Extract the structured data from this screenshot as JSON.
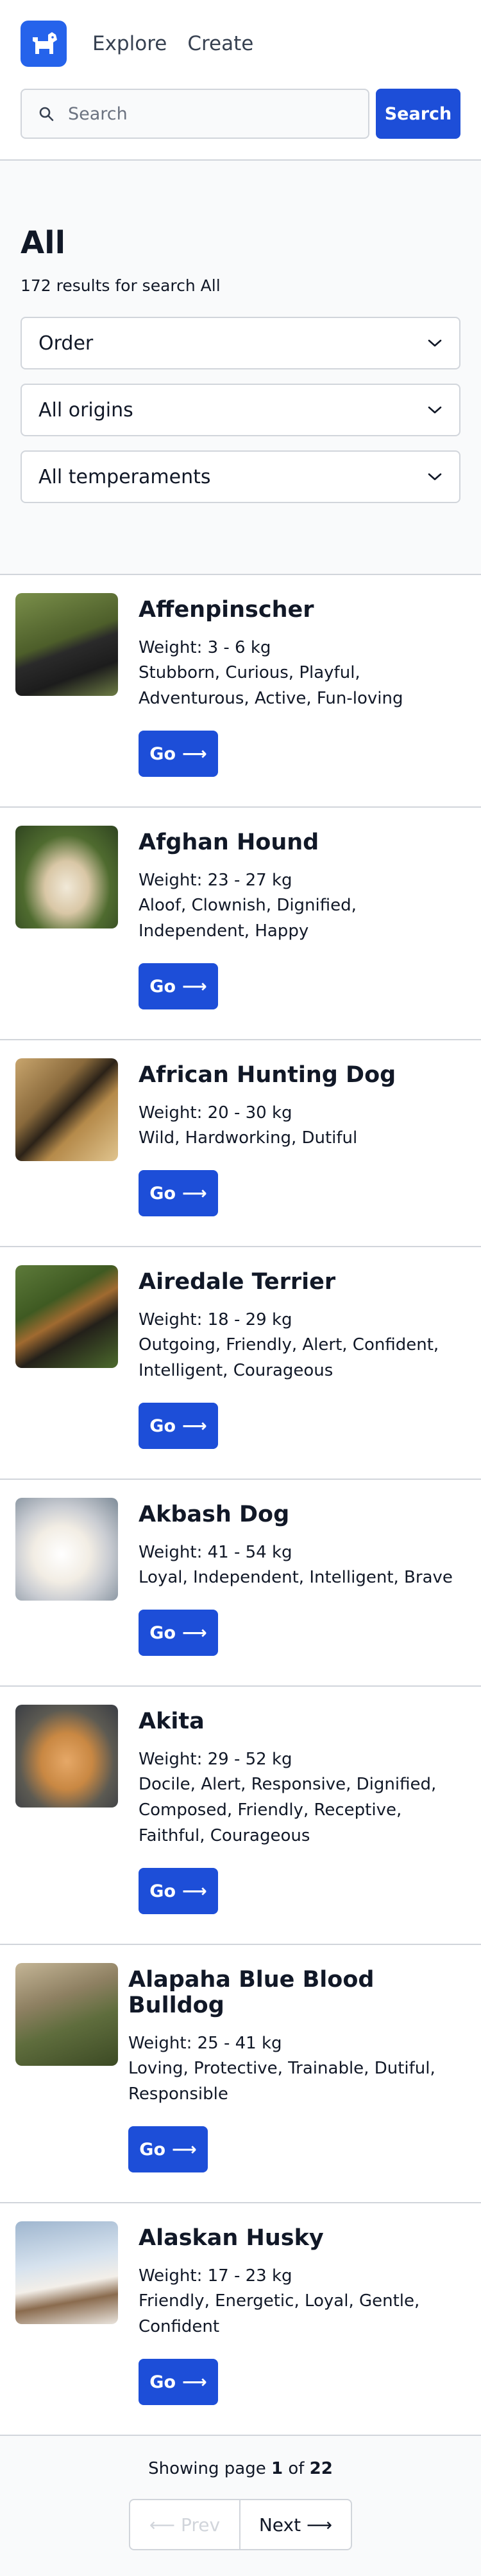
{
  "nav": {
    "explore": "Explore",
    "create": "Create"
  },
  "search": {
    "placeholder": "Search",
    "button": "Search"
  },
  "page": {
    "title": "All",
    "results": "172 results for search All"
  },
  "filters": {
    "order": "Order",
    "origin": "All origins",
    "temperament": "All temperaments"
  },
  "breeds": [
    {
      "name": "Affenpinscher",
      "weight": "Weight: 3 - 6 kg",
      "temperament": "Stubborn, Curious, Playful, Adventurous, Active, Fun-loving",
      "button": "Go"
    },
    {
      "name": "Afghan Hound",
      "weight": "Weight: 23 - 27 kg",
      "temperament": "Aloof, Clownish, Dignified, Independent, Happy",
      "button": "Go"
    },
    {
      "name": "African Hunting Dog",
      "weight": "Weight: 20 - 30 kg",
      "temperament": "Wild, Hardworking, Dutiful",
      "button": "Go"
    },
    {
      "name": "Airedale Terrier",
      "weight": "Weight: 18 - 29 kg",
      "temperament": "Outgoing, Friendly, Alert, Confident, Intelligent, Courageous",
      "button": "Go"
    },
    {
      "name": "Akbash Dog",
      "weight": "Weight: 41 - 54 kg",
      "temperament": "Loyal, Independent, Intelligent, Brave",
      "button": "Go"
    },
    {
      "name": "Akita",
      "weight": "Weight: 29 - 52 kg",
      "temperament": "Docile, Alert, Responsive, Dignified, Composed, Friendly, Receptive, Faithful, Courageous",
      "button": "Go"
    },
    {
      "name": "Alapaha Blue Blood Bulldog",
      "weight": "Weight: 25 - 41 kg",
      "temperament": "Loving, Protective, Trainable, Dutiful, Responsible",
      "button": "Go"
    },
    {
      "name": "Alaskan Husky",
      "weight": "Weight: 17 - 23 kg",
      "temperament": "Friendly, Energetic, Loyal, Gentle, Confident",
      "button": "Go"
    }
  ],
  "pagination": {
    "showing": "Showing page",
    "current": "1",
    "of": "of",
    "total": "22",
    "prev": "Prev",
    "next": "Next"
  },
  "colors": {
    "primary": "#1d4ed8",
    "logo": "#2563eb",
    "border": "#d1d5db",
    "section_bg": "#f9fafb"
  }
}
